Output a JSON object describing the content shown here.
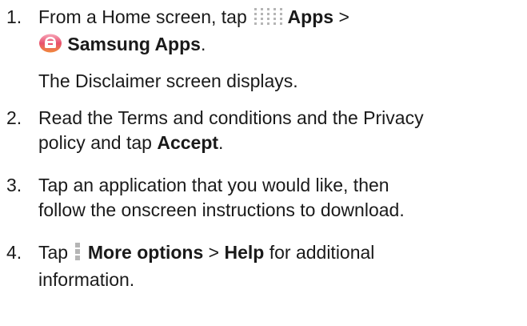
{
  "steps": [
    {
      "number": "1.",
      "line1_prefix": "From a Home screen, tap",
      "apps_label": "Apps",
      "separator": ">",
      "samsung_apps_label": "Samsung Apps",
      "end_period": ".",
      "note": "The Disclaimer screen displays.",
      "icons": [
        "apps-grid-icon",
        "samsung-apps-icon"
      ]
    },
    {
      "number": "2.",
      "text_line1": "Read the Terms and conditions and the Privacy",
      "text_line2_prefix": "policy and tap",
      "accept_label": "Accept",
      "end_period": "."
    },
    {
      "number": "3.",
      "text_line1": "Tap an application that you would like, then",
      "text_line2": "follow the onscreen instructions to download."
    },
    {
      "number": "4.",
      "prefix": "Tap",
      "more_options_label": "More options",
      "separator": ">",
      "help_label": "Help",
      "suffix": "for additional",
      "text_line2": "information.",
      "icons": [
        "more-options-icon"
      ]
    }
  ]
}
